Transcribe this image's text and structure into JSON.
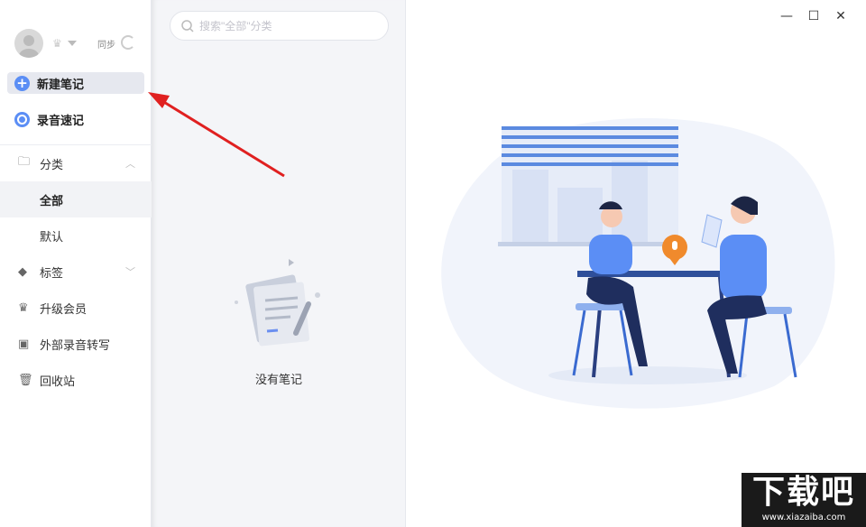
{
  "sidebar": {
    "sync_label": "同步",
    "new_note": "新建笔记",
    "voice_note": "录音速记",
    "items": [
      {
        "label": "分类",
        "icon": "folder-icon"
      },
      {
        "label": "全部"
      },
      {
        "label": "默认"
      },
      {
        "label": "标签",
        "icon": "tag-icon"
      },
      {
        "label": "升级会员",
        "icon": "crown-icon"
      },
      {
        "label": "外部录音转写",
        "icon": "recorder-icon"
      },
      {
        "label": "回收站",
        "icon": "trash-icon"
      }
    ]
  },
  "notes": {
    "search_placeholder": "搜索\"全部\"分类",
    "empty_text": "没有笔记"
  },
  "window": {
    "minimize": "—",
    "maximize": "☐",
    "close": "✕"
  },
  "watermark": {
    "title": "下载吧",
    "url": "www.xiazaiba.com"
  },
  "colors": {
    "accent": "#5b8ef5",
    "arrow": "#e02020"
  }
}
